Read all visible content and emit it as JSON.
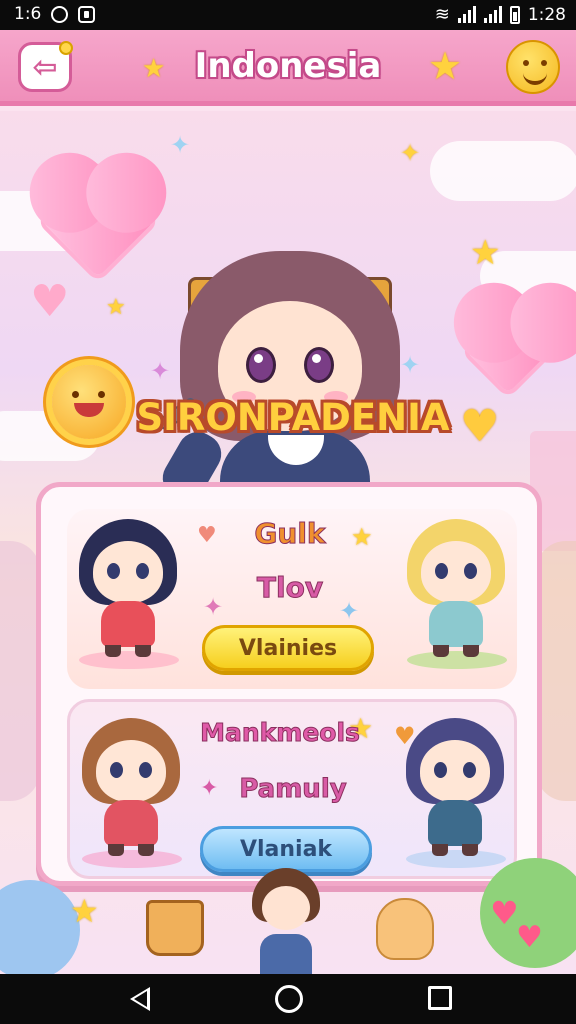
{
  "status_bar": {
    "time_left": "1:6",
    "time_right": "1:28"
  },
  "header": {
    "title": "Indonesia",
    "back_icon": "back-arrow-icon",
    "profile_icon": "smiley-icon"
  },
  "hero": {
    "game_title": "SIRONPADENIA"
  },
  "panel": {
    "row1": {
      "label_top": "Gulk",
      "label_mid": "Tlov",
      "button": "Vlainies"
    },
    "row2": {
      "label_top": "Mankmeols",
      "label_mid": "Pamuly",
      "button": "Vlaniak"
    }
  },
  "bottom_bar": {
    "items": [
      "basket-icon",
      "boy-character",
      "bear-toy-icon"
    ]
  },
  "colors": {
    "header_pink": "#ef8fba",
    "title_yellow": "#ffcf3e",
    "yellow_button": "#f6cf1e",
    "blue_button": "#6fbdf2",
    "panel_border": "#f1a8c8"
  }
}
